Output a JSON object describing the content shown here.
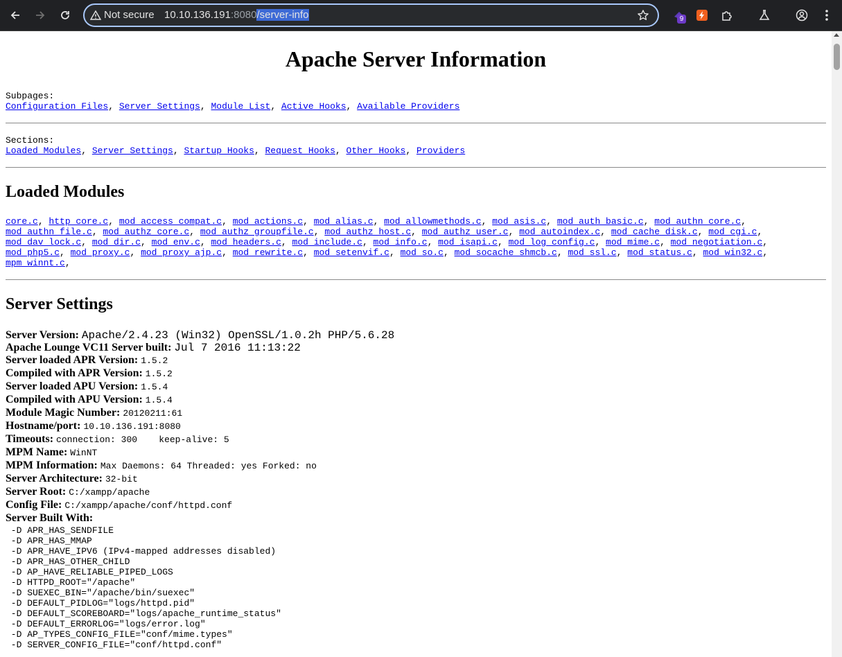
{
  "browser": {
    "not_secure": "Not secure",
    "url_host": "10.10.136.191",
    "url_port": ":8080",
    "url_path": "/server-info",
    "extension_badge": "9"
  },
  "page": {
    "title": "Apache Server Information",
    "subpages_label": "Subpages:",
    "subpages": [
      "Configuration Files",
      "Server Settings",
      "Module List",
      "Active Hooks",
      "Available Providers"
    ],
    "sections_label": "Sections:",
    "sections": [
      "Loaded Modules",
      "Server Settings",
      "Startup Hooks",
      "Request Hooks",
      "Other Hooks",
      "Providers"
    ],
    "loaded_modules_heading": "Loaded Modules",
    "module_lines": [
      [
        "core.c",
        "http_core.c",
        "mod_access_compat.c",
        "mod_actions.c",
        "mod_alias.c",
        "mod_allowmethods.c",
        "mod_asis.c",
        "mod_auth_basic.c",
        "mod_authn_core.c"
      ],
      [
        "mod_authn_file.c",
        "mod_authz_core.c",
        "mod_authz_groupfile.c",
        "mod_authz_host.c",
        "mod_authz_user.c",
        "mod_autoindex.c",
        "mod_cache_disk.c",
        "mod_cgi.c"
      ],
      [
        "mod_dav_lock.c",
        "mod_dir.c",
        "mod_env.c",
        "mod_headers.c",
        "mod_include.c",
        "mod_info.c",
        "mod_isapi.c",
        "mod_log_config.c",
        "mod_mime.c",
        "mod_negotiation.c"
      ],
      [
        "mod_php5.c",
        "mod_proxy.c",
        "mod_proxy_ajp.c",
        "mod_rewrite.c",
        "mod_setenvif.c",
        "mod_so.c",
        "mod_socache_shmcb.c",
        "mod_ssl.c",
        "mod_status.c",
        "mod_win32.c"
      ],
      [
        "mpm_winnt.c"
      ]
    ],
    "server_settings_heading": "Server Settings",
    "settings": [
      {
        "label": "Server Version:",
        "value": "Apache/2.4.23 (Win32) OpenSSL/1.0.2h PHP/5.6.28",
        "big": true
      },
      {
        "label": "Apache Lounge VC11 Server built:",
        "value": "Jul 7 2016 11:13:22",
        "big": true
      },
      {
        "label": "Server loaded APR Version:",
        "value": "1.5.2"
      },
      {
        "label": "Compiled with APR Version:",
        "value": "1.5.2"
      },
      {
        "label": "Server loaded APU Version:",
        "value": "1.5.4"
      },
      {
        "label": "Compiled with APU Version:",
        "value": "1.5.4"
      },
      {
        "label": "Module Magic Number:",
        "value": "20120211:61"
      },
      {
        "label": "Hostname/port:",
        "value": "10.10.136.191:8080"
      },
      {
        "label": "Timeouts:",
        "value": "connection: 300    keep-alive: 5"
      },
      {
        "label": "MPM Name:",
        "value": "WinNT"
      },
      {
        "label": "MPM Information:",
        "value": "Max Daemons: 64 Threaded: yes Forked: no"
      },
      {
        "label": "Server Architecture:",
        "value": "32-bit"
      },
      {
        "label": "Server Root:",
        "value": "C:/xampp/apache"
      },
      {
        "label": "Config File:",
        "value": "C:/xampp/apache/conf/httpd.conf"
      }
    ],
    "built_with_label": "Server Built With:",
    "built_with": [
      " -D APR_HAS_SENDFILE",
      " -D APR_HAS_MMAP",
      " -D APR_HAVE_IPV6 (IPv4-mapped addresses disabled)",
      " -D APR_HAS_OTHER_CHILD",
      " -D AP_HAVE_RELIABLE_PIPED_LOGS",
      " -D HTTPD_ROOT=\"/apache\"",
      " -D SUEXEC_BIN=\"/apache/bin/suexec\"",
      " -D DEFAULT_PIDLOG=\"logs/httpd.pid\"",
      " -D DEFAULT_SCOREBOARD=\"logs/apache_runtime_status\"",
      " -D DEFAULT_ERRORLOG=\"logs/error.log\"",
      " -D AP_TYPES_CONFIG_FILE=\"conf/mime.types\"",
      " -D SERVER_CONFIG_FILE=\"conf/httpd.conf\""
    ]
  }
}
